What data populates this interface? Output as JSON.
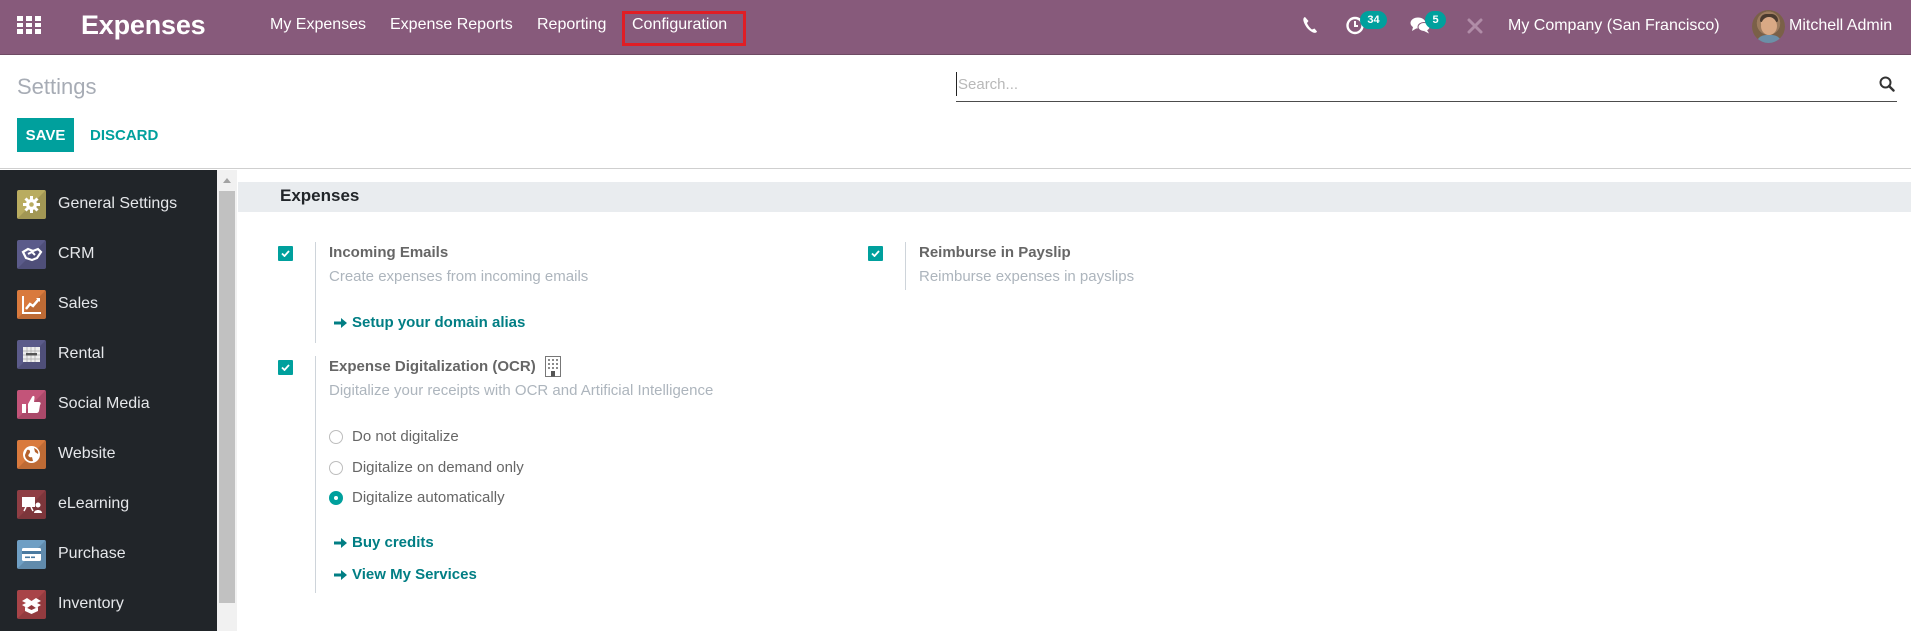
{
  "navbar": {
    "apps_icon": "apps-grid-icon",
    "app_name": "Expenses",
    "menu": [
      {
        "label": "My Expenses"
      },
      {
        "label": "Expense Reports"
      },
      {
        "label": "Reporting"
      },
      {
        "label": "Configuration",
        "highlighted": true
      }
    ],
    "systray": {
      "phone_icon": "phone-icon",
      "activity_icon": "clock-icon",
      "activity_count": "34",
      "messages_icon": "chat-icon",
      "messages_count": "5",
      "debug_icon": "tools-icon",
      "company": "My Company (San Francisco)",
      "user_name": "Mitchell Admin"
    },
    "colors": {
      "background": "#875a7b",
      "highlight": "#e01e25",
      "badge": "#00a09d"
    }
  },
  "control_panel": {
    "title": "Settings",
    "save_label": "SAVE",
    "discard_label": "DISCARD",
    "search": {
      "placeholder": "Search...",
      "value": ""
    }
  },
  "sidebar": {
    "items": [
      {
        "label": "General Settings",
        "icon": "gear-icon",
        "color": "#b9ac60"
      },
      {
        "label": "CRM",
        "icon": "handshake-icon",
        "color": "#5b5b8a"
      },
      {
        "label": "Sales",
        "icon": "chart-up-icon",
        "color": "#d97a3d"
      },
      {
        "label": "Rental",
        "icon": "calendar-grid-icon",
        "color": "#5b5b8a"
      },
      {
        "label": "Social Media",
        "icon": "thumbs-up-icon",
        "color": "#c35479"
      },
      {
        "label": "Website",
        "icon": "globe-icon",
        "color": "#d97a3d"
      },
      {
        "label": "eLearning",
        "icon": "presentation-icon",
        "color": "#8f3e44"
      },
      {
        "label": "Purchase",
        "icon": "credit-card-icon",
        "color": "#6f9fc4"
      },
      {
        "label": "Inventory",
        "icon": "box-icon",
        "color": "#a84448"
      }
    ]
  },
  "settings": {
    "section_title": "Expenses",
    "left": [
      {
        "title": "Incoming Emails",
        "description": "Create expenses from incoming emails",
        "checked": true,
        "links": [
          "Setup your domain alias"
        ]
      },
      {
        "title": "Expense Digitalization (OCR)",
        "enterprise_icon": "building-icon",
        "description": "Digitalize your receipts with OCR and Artificial Intelligence",
        "checked": true,
        "radio_options": [
          {
            "label": "Do not digitalize",
            "selected": false
          },
          {
            "label": "Digitalize on demand only",
            "selected": false
          },
          {
            "label": "Digitalize automatically",
            "selected": true
          }
        ],
        "links": [
          "Buy credits",
          "View My Services"
        ]
      }
    ],
    "right": [
      {
        "title": "Reimburse in Payslip",
        "description": "Reimburse expenses in payslips",
        "checked": true
      }
    ]
  }
}
